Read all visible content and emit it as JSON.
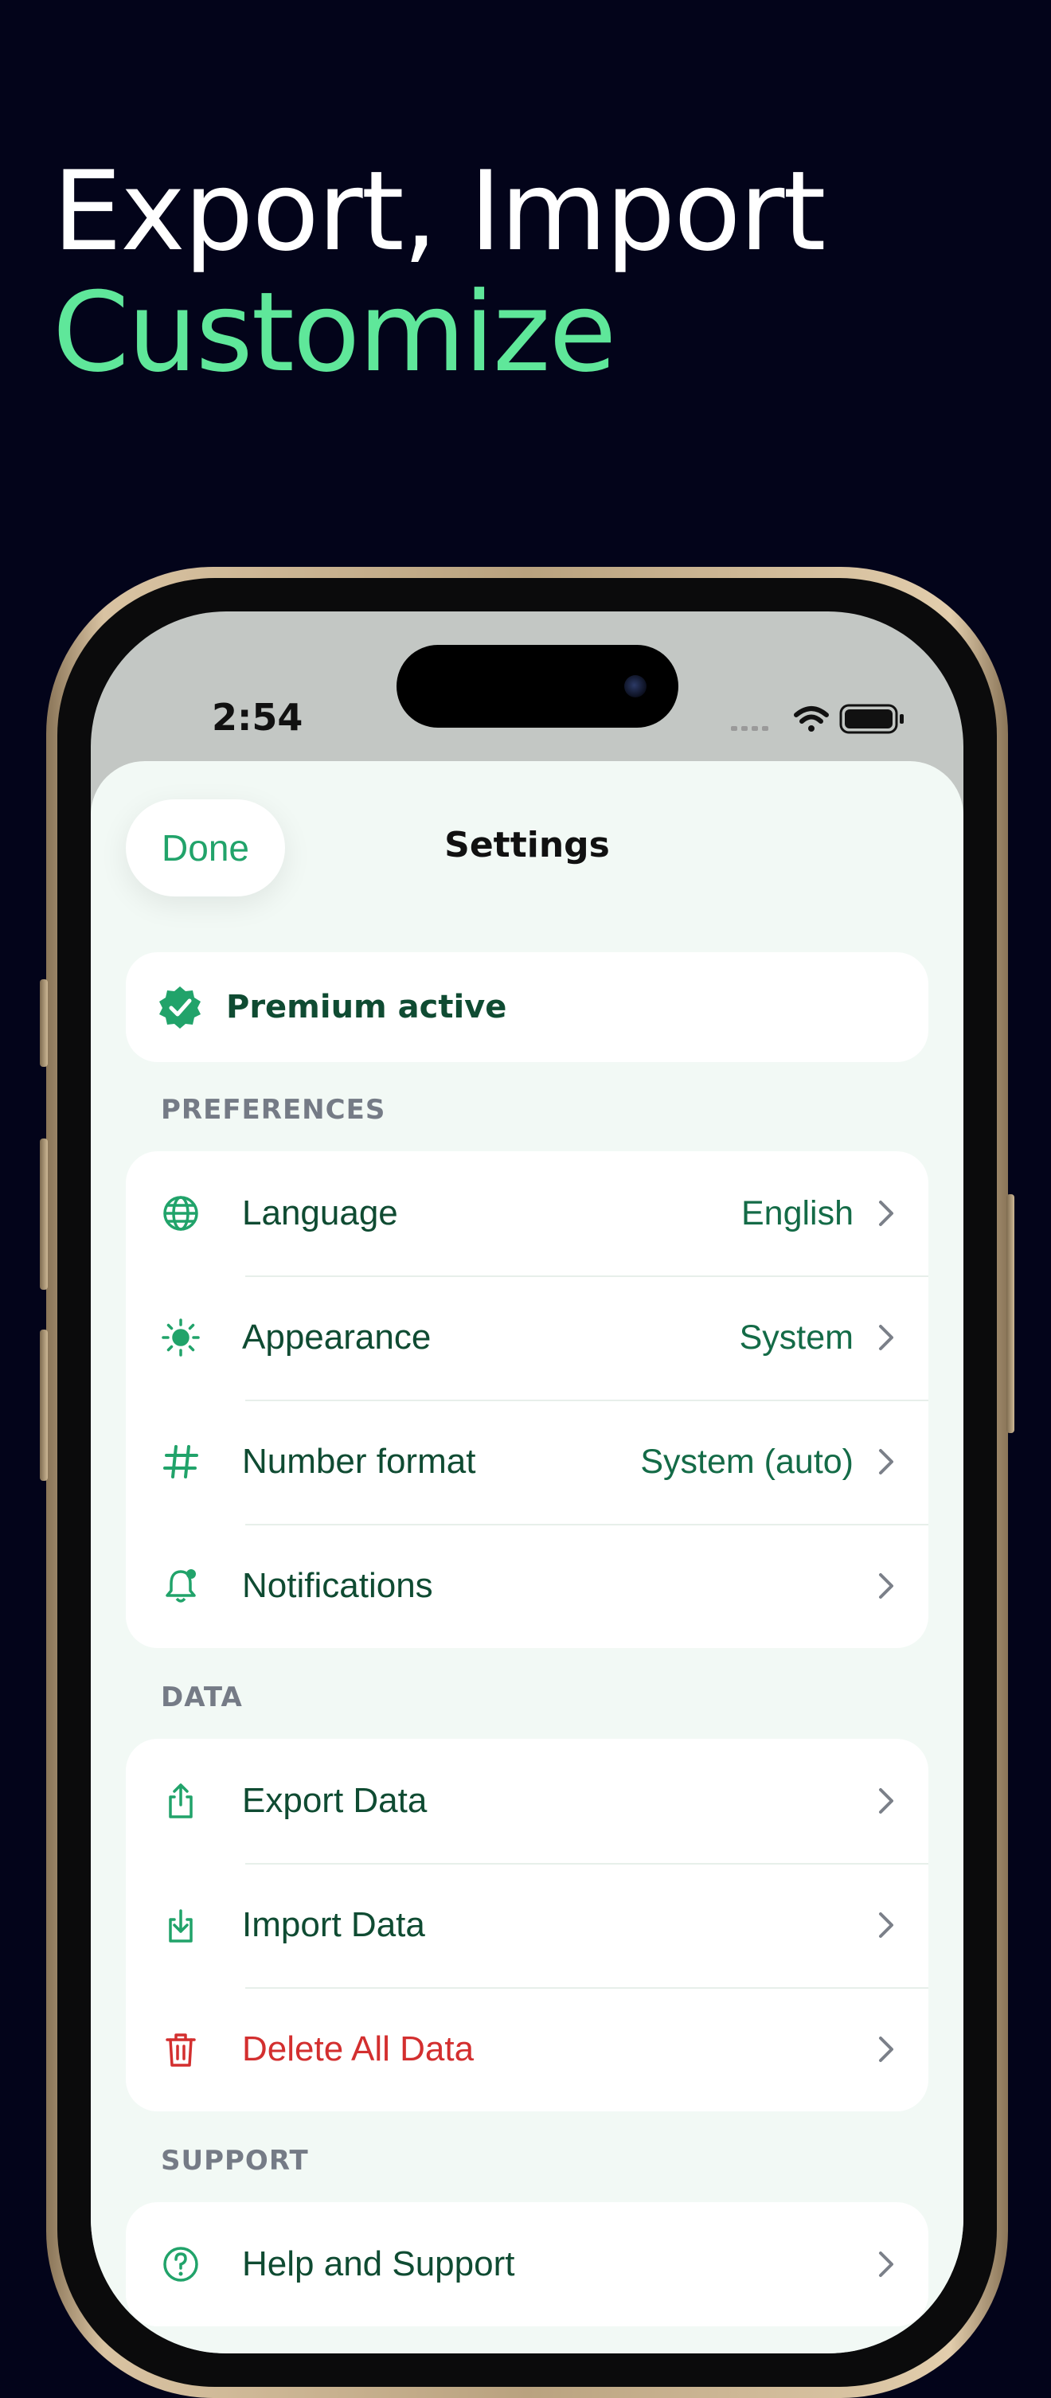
{
  "headline": {
    "line1": "Export, Import",
    "line2": "Customize"
  },
  "status_bar": {
    "time": "2:54"
  },
  "sheet": {
    "done_label": "Done",
    "title": "Settings"
  },
  "premium": {
    "label": "Premium active"
  },
  "sections": {
    "preferences": {
      "title": "PREFERENCES",
      "rows": [
        {
          "label": "Language",
          "value": "English",
          "icon": "globe-icon"
        },
        {
          "label": "Appearance",
          "value": "System",
          "icon": "sun-icon"
        },
        {
          "label": "Number format",
          "value": "System (auto)",
          "icon": "hash-icon"
        },
        {
          "label": "Notifications",
          "value": "",
          "icon": "bell-icon"
        }
      ]
    },
    "data": {
      "title": "DATA",
      "rows": [
        {
          "label": "Export Data",
          "icon": "share-upload-icon"
        },
        {
          "label": "Import Data",
          "icon": "download-icon"
        },
        {
          "label": "Delete All Data",
          "icon": "trash-icon"
        }
      ]
    },
    "support": {
      "title": "SUPPORT",
      "rows": [
        {
          "label": "Help and Support",
          "icon": "help-circle-icon"
        }
      ]
    }
  },
  "colors": {
    "background": "#03041a",
    "accent_green": "#21a36a",
    "headline_green": "#5fe79a",
    "text_dark_green": "#0f4b32",
    "danger_red": "#d32f2f"
  }
}
